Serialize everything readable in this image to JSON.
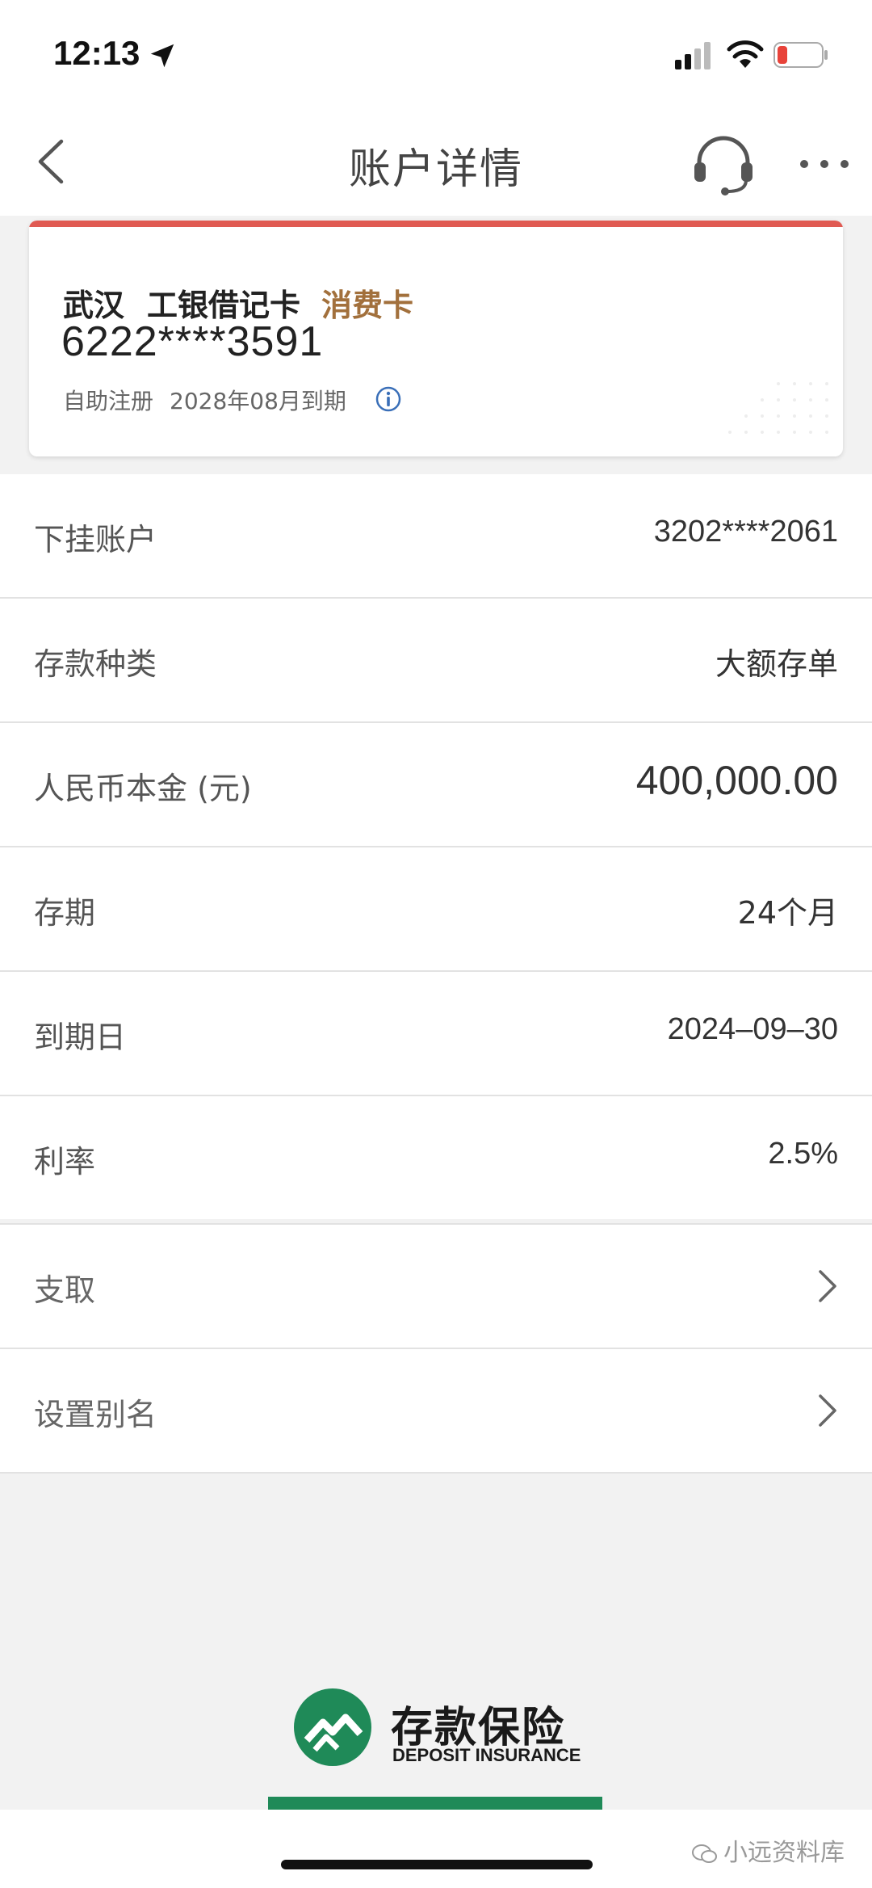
{
  "status_bar": {
    "time": "12:13"
  },
  "nav": {
    "title": "账户详情"
  },
  "card": {
    "city": "武汉",
    "card_name": "工银借记卡",
    "card_type": "消费卡",
    "number": "6222****3591",
    "register": "自助注册",
    "expiry": "2028年08月到期",
    "accent_color": "#e05a52"
  },
  "details": [
    {
      "label": "下挂账户",
      "value": "3202****2061"
    },
    {
      "label": "存款种类",
      "value": "大额存单"
    },
    {
      "label": "人民币本金 (元)",
      "value": "400,000.00"
    },
    {
      "label": "存期",
      "value": "24个月"
    },
    {
      "label": "到期日",
      "value": "2024–09–30"
    },
    {
      "label": "利率",
      "value": "2.5%"
    }
  ],
  "actions": [
    {
      "label": "支取"
    },
    {
      "label": "设置别名"
    }
  ],
  "deposit_insurance": {
    "cn": "存款保险",
    "en": "DEPOSIT INSURANCE",
    "brand_color": "#1f8a58"
  },
  "watermark": "小远资料库",
  "icons": [
    "location-arrow-icon",
    "signal-icon",
    "wifi-icon",
    "battery-icon",
    "back-chevron-icon",
    "headset-icon",
    "more-dots-icon",
    "info-icon",
    "chevron-right-icon",
    "deposit-insurance-logo",
    "wechat-icon"
  ]
}
